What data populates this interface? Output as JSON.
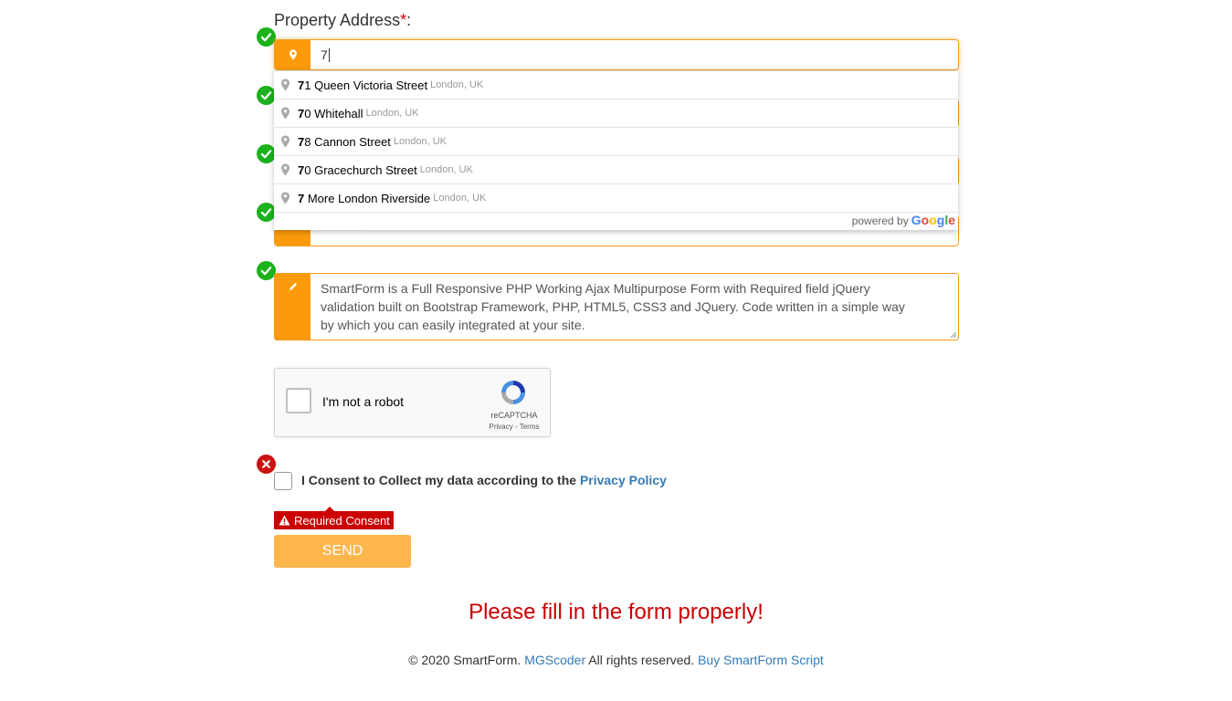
{
  "property_address": {
    "label": "Property Address",
    "required_mark": "*",
    "colon": ":",
    "input_value": "7"
  },
  "autocomplete": {
    "items": [
      {
        "match": "7",
        "rest": "1 Queen Victoria Street",
        "secondary": "London, UK"
      },
      {
        "match": "7",
        "rest": "0 Whitehall",
        "secondary": "London, UK"
      },
      {
        "match": "7",
        "rest": "8 Cannon Street",
        "secondary": "London, UK"
      },
      {
        "match": "7",
        "rest": "0 Gracechurch Street",
        "secondary": "London, UK"
      },
      {
        "match": "7",
        "rest": " More London Riverside",
        "secondary": "London, UK"
      }
    ],
    "powered_by": "powered by",
    "google_letters": [
      "G",
      "o",
      "o",
      "g",
      "l",
      "e"
    ],
    "google_colors": [
      "#4285F4",
      "#EA4335",
      "#FBBC05",
      "#4285F4",
      "#34A853",
      "#EA4335"
    ]
  },
  "hidden_phone_fragment": "''''''''''''",
  "message": {
    "text": "SmartForm is a Full Responsive PHP Working Ajax Multipurpose Form with Required field jQuery validation built on Bootstrap Framework, PHP, HTML5, CSS3 and JQuery. Code written in a simple way by which you can easily integrated at your site."
  },
  "recaptcha": {
    "label": "I'm not a robot",
    "brand": "reCAPTCHA",
    "links": "Privacy - Terms"
  },
  "consent": {
    "text": "I Consent to Collect my data according to the",
    "link": "Privacy Policy",
    "error": "Required Consent"
  },
  "send_button": "SEND",
  "form_error": "Please fill in the form properly!",
  "footer": {
    "copyright": "© 2020 SmartForm.",
    "author_link": "MGScoder",
    "rights": "All rights reserved.",
    "buy_link": "Buy SmartForm Script"
  },
  "colors": {
    "accent": "#fb9a0a",
    "valid": "#1bb21b",
    "error": "#cc0000",
    "link": "#337ab7",
    "send": "#fdb64c"
  },
  "icons": [
    "map-marker-icon",
    "check-icon",
    "close-icon",
    "pencil-icon",
    "recaptcha-logo-icon",
    "warning-icon"
  ]
}
